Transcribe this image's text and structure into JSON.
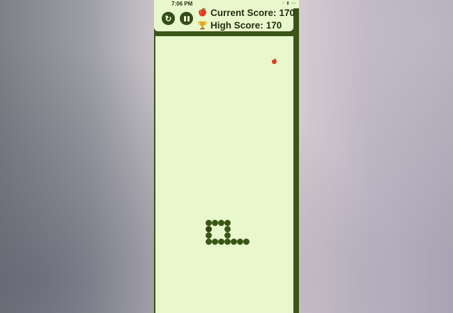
{
  "status_bar": {
    "time": "7:06 PM",
    "icons": [
      "wifi-icon",
      "signal-icon",
      "battery-icon"
    ]
  },
  "header": {
    "buttons": [
      {
        "name": "restart-button",
        "icon": "restart-icon"
      },
      {
        "name": "pause-button",
        "icon": "pause-icon"
      }
    ],
    "current_score": {
      "icon": "apple-icon",
      "label": "Current Score:",
      "value": "170"
    },
    "high_score": {
      "icon": "trophy-icon",
      "label": "High Score:",
      "value": "170"
    }
  },
  "game": {
    "food": {
      "icon": "apple-icon",
      "cell": [
        18,
        3
      ]
    },
    "snake": [
      [
        10,
        32
      ],
      [
        10,
        31
      ],
      [
        11,
        31
      ],
      [
        12,
        31
      ],
      [
        13,
        31
      ],
      [
        13,
        32
      ],
      [
        13,
        33
      ],
      [
        13,
        34
      ],
      [
        12,
        34
      ],
      [
        11,
        34
      ],
      [
        10,
        34
      ],
      [
        10,
        33
      ],
      [
        14,
        34
      ],
      [
        15,
        34
      ],
      [
        16,
        34
      ]
    ],
    "colors": {
      "board": "#e9f8cc",
      "frame": "#3b5519",
      "snake": "#3a5518",
      "food": "#e53a22"
    }
  }
}
